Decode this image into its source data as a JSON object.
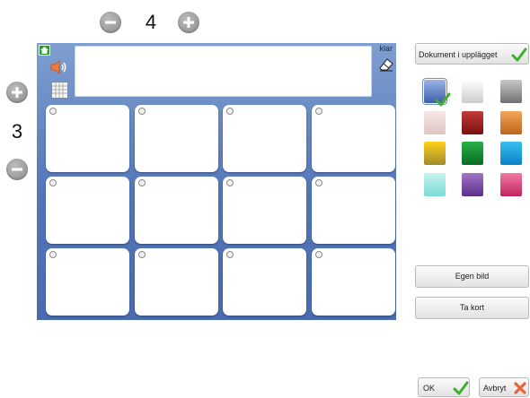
{
  "columns_control": {
    "value": "4"
  },
  "rows_control": {
    "value": "3"
  },
  "board": {
    "klar_label": "klar",
    "sentence_text": "",
    "card_count": 12
  },
  "right_panel": {
    "document_button_label": "Dokument i upplägget",
    "own_image_label": "Egen bild",
    "take_card_label": "Ta kort",
    "selected_color": "blue"
  },
  "colors": {
    "swatches": [
      {
        "name": "blue",
        "top": "#9cb3e6",
        "bottom": "#3d5faa"
      },
      {
        "name": "white",
        "top": "#ffffff",
        "bottom": "#cccccc"
      },
      {
        "name": "gray",
        "top": "#c9c9c9",
        "bottom": "#6f6f6f"
      },
      {
        "name": "pink-light",
        "top": "#f7e6e6",
        "bottom": "#e0c4c4"
      },
      {
        "name": "red",
        "top": "#c33a3a",
        "bottom": "#7a0f0f"
      },
      {
        "name": "orange",
        "top": "#f0a85a",
        "bottom": "#c0621a"
      },
      {
        "name": "yellow-olive",
        "top": "#ffd21a",
        "bottom": "#a08a2c"
      },
      {
        "name": "green",
        "top": "#2ab04a",
        "bottom": "#0b6b22"
      },
      {
        "name": "cyan",
        "top": "#38c2f0",
        "bottom": "#0a7fc8"
      },
      {
        "name": "aqua",
        "top": "#c8f2ee",
        "bottom": "#79dcd3"
      },
      {
        "name": "purple",
        "top": "#a276c6",
        "bottom": "#5c2f8a"
      },
      {
        "name": "magenta",
        "top": "#f37aa5",
        "bottom": "#c0235e"
      }
    ],
    "accent_green": "#3fae2f",
    "cancel_orange": "#e8643a"
  },
  "footer": {
    "ok_label": "OK",
    "cancel_label": "Avbryt"
  }
}
